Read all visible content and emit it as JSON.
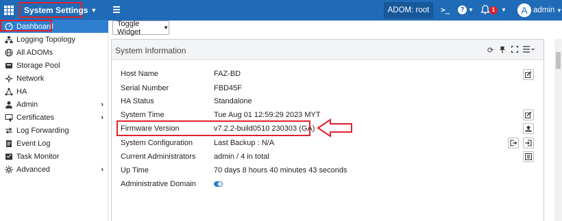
{
  "topbar": {
    "app_menu": "System Settings",
    "adom": "ADOM: root",
    "notification_count": "1",
    "avatar_letter": "A",
    "user": "admin"
  },
  "sidebar": {
    "items": [
      {
        "label": "Dashboard",
        "icon": "dashboard-icon"
      },
      {
        "label": "Logging Topology",
        "icon": "topology-icon"
      },
      {
        "label": "All ADOMs",
        "icon": "globe-icon"
      },
      {
        "label": "Storage Pool",
        "icon": "storage-icon"
      },
      {
        "label": "Network",
        "icon": "network-icon"
      },
      {
        "label": "HA",
        "icon": "ha-icon"
      },
      {
        "label": "Admin",
        "icon": "admin-icon"
      },
      {
        "label": "Certificates",
        "icon": "certificate-icon"
      },
      {
        "label": "Log Forwarding",
        "icon": "forward-icon"
      },
      {
        "label": "Event Log",
        "icon": "event-log-icon"
      },
      {
        "label": "Task Monitor",
        "icon": "task-icon"
      },
      {
        "label": "Advanced",
        "icon": "advanced-icon"
      }
    ]
  },
  "toolbar": {
    "toggle_widget": "Toggle Widget"
  },
  "panel": {
    "title": "System Information",
    "rows": [
      {
        "label": "Host Name",
        "value": "FAZ-BD"
      },
      {
        "label": "Serial Number",
        "value": "FBD45F"
      },
      {
        "label": "HA Status",
        "value": "Standalone"
      },
      {
        "label": "System Time",
        "value": "Tue Aug 01 12:59:29 2023 MYT"
      },
      {
        "label": "Firmware Version",
        "value": "v7.2.2-build0510 230303 (GA)"
      },
      {
        "label": "System Configuration",
        "value": "Last Backup : N/A"
      },
      {
        "label": "Current Administrators",
        "value": "admin / 4 in total"
      },
      {
        "label": "Up Time",
        "value": "70 days 8 hours 40 minutes 43 seconds"
      },
      {
        "label": "Administrative Domain",
        "value": ""
      }
    ]
  },
  "colors": {
    "topbar": "#1f6bb7",
    "active": "#2f7fd0",
    "highlight": "#e0202a"
  }
}
